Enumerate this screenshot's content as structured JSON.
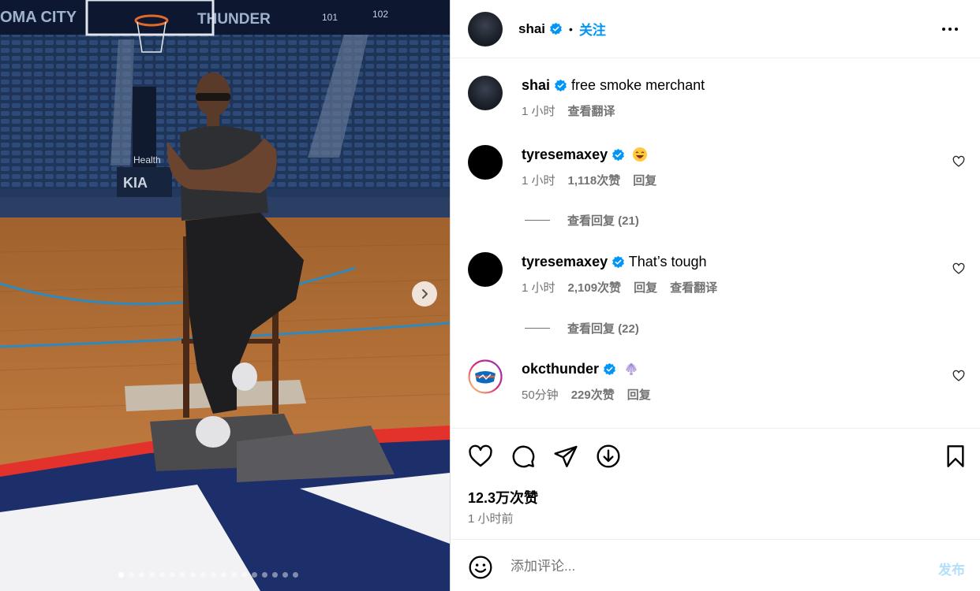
{
  "media": {
    "arena_banner_left": "OMA CITY",
    "arena_banner_right": "THUNDER",
    "section_101": "101",
    "section_102": "102",
    "health_sign": "Health",
    "kia_sign": "KIA",
    "next_icon": "chevron-right-icon",
    "carousel_count": 18,
    "carousel_active": 0
  },
  "header": {
    "username": "shai",
    "separator": "•",
    "follow_label": "关注"
  },
  "caption": {
    "username": "shai",
    "text": "free smoke merchant",
    "time": "1 小时",
    "translate": "查看翻译"
  },
  "comments": [
    {
      "username": "tyresemaxey",
      "text": "",
      "emoji": "laughing-face-emoji",
      "time": "1 小时",
      "likes": "1,118次赞",
      "reply": "回复",
      "view_replies": "查看回复 (21)"
    },
    {
      "username": "tyresemaxey",
      "text": "That’s tough",
      "time": "1 小时",
      "likes": "2,109次赞",
      "reply": "回复",
      "translate": "查看翻译",
      "view_replies": "查看回复 (22)"
    },
    {
      "username": "okcthunder",
      "text": "",
      "emoji": "shell-emoji",
      "time": "50分钟",
      "likes": "229次赞",
      "reply": "回复"
    }
  ],
  "stats": {
    "likes": "12.3万次赞",
    "posted": "1 小时前"
  },
  "composer": {
    "placeholder": "添加评论...",
    "post_label": "发布"
  },
  "colors": {
    "link_blue": "#0095f6",
    "muted": "#737373",
    "post_disabled": "#b2dffc"
  }
}
